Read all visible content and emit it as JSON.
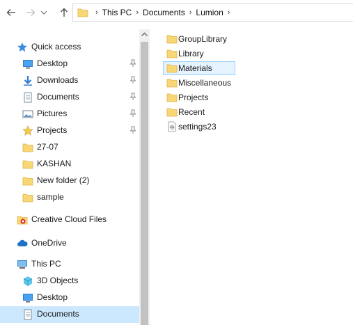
{
  "address": {
    "crumbs": [
      "This PC",
      "Documents",
      "Lumion"
    ]
  },
  "sidebar": {
    "quick_access": {
      "label": "Quick access"
    },
    "pinned": [
      {
        "label": "Desktop",
        "icon": "desktop-icon"
      },
      {
        "label": "Downloads",
        "icon": "download-icon"
      },
      {
        "label": "Documents",
        "icon": "documents-icon"
      },
      {
        "label": "Pictures",
        "icon": "pictures-icon"
      },
      {
        "label": "Projects",
        "icon": "star-folder-icon"
      }
    ],
    "recent": [
      {
        "label": "27-07"
      },
      {
        "label": "KASHAN"
      },
      {
        "label": "New folder (2)"
      },
      {
        "label": "sample"
      }
    ],
    "creative_cloud": {
      "label": "Creative Cloud Files"
    },
    "onedrive": {
      "label": "OneDrive"
    },
    "this_pc": {
      "label": "This PC"
    },
    "this_pc_items": [
      {
        "label": "3D Objects"
      },
      {
        "label": "Desktop"
      },
      {
        "label": "Documents"
      }
    ]
  },
  "files": [
    {
      "label": "GroupLibrary",
      "type": "folder"
    },
    {
      "label": "Library",
      "type": "folder"
    },
    {
      "label": "Materials",
      "type": "folder",
      "selected": true
    },
    {
      "label": "Miscellaneous",
      "type": "folder"
    },
    {
      "label": "Projects",
      "type": "folder"
    },
    {
      "label": "Recent",
      "type": "folder"
    },
    {
      "label": "settings23",
      "type": "settings-file"
    }
  ],
  "colors": {
    "folder": "#f8d775",
    "selection": "#cce8ff",
    "accent": "#0078d7"
  }
}
